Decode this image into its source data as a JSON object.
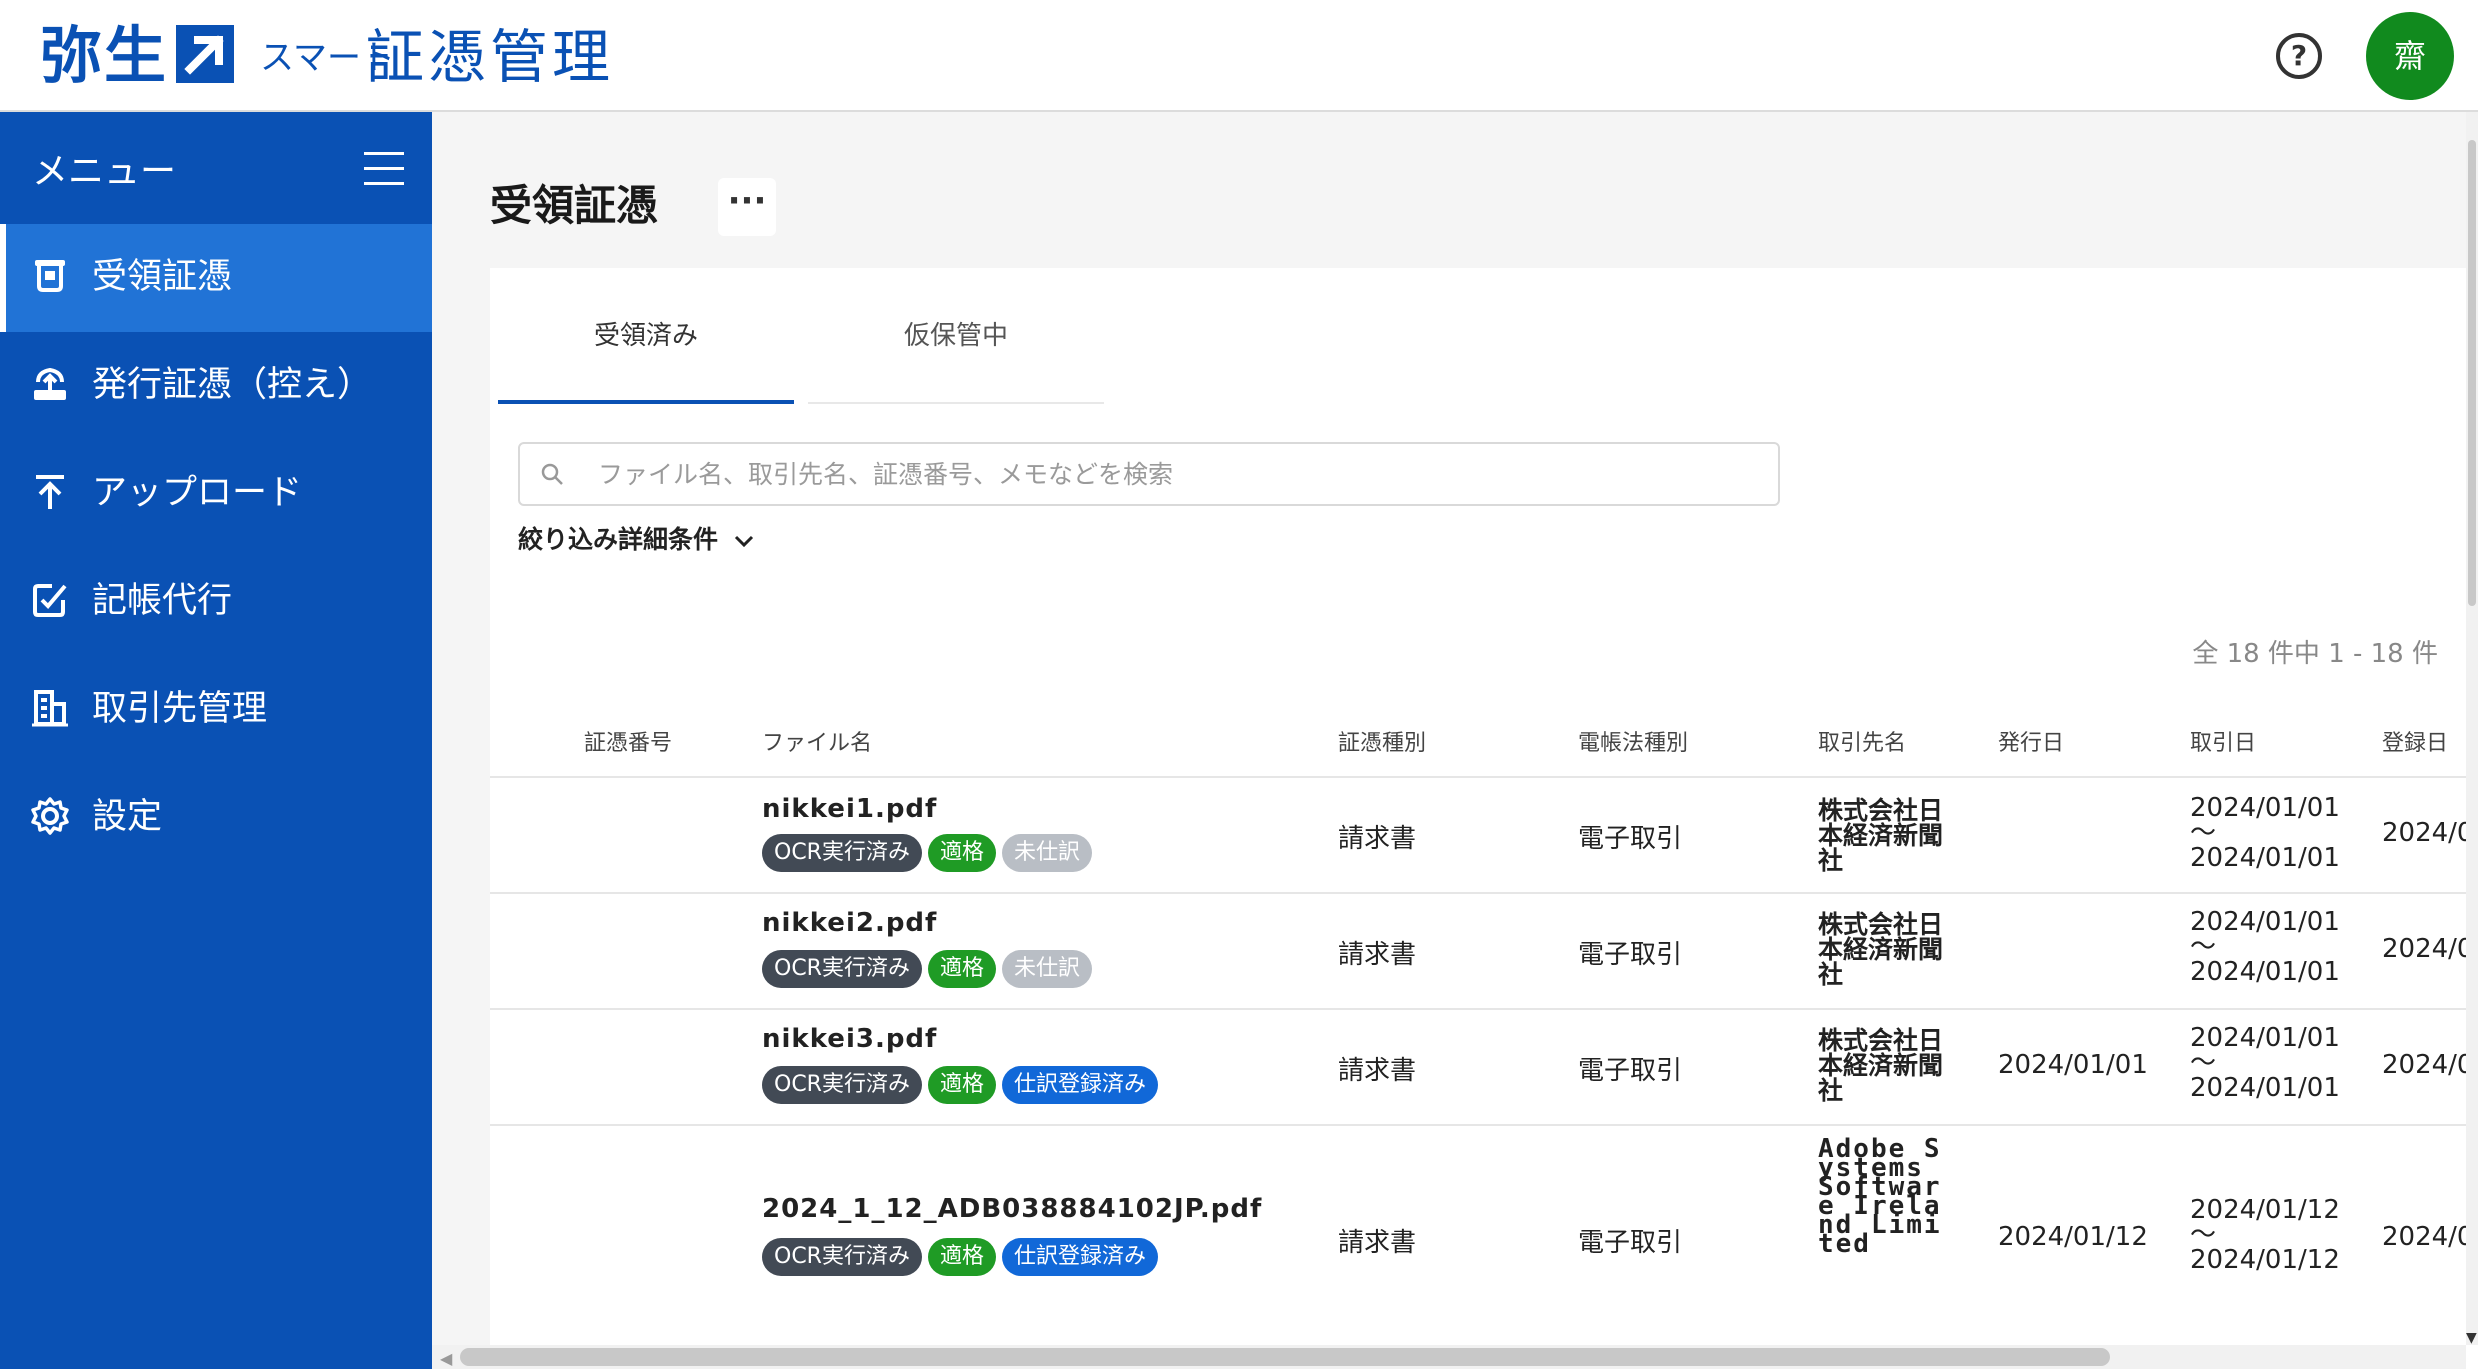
{
  "header": {
    "brand": "弥生",
    "brand_sub": "スマート",
    "product": "証憑管理",
    "help_label": "?",
    "avatar_label": "齋"
  },
  "sidebar": {
    "menu_title": "メニュー",
    "items": [
      {
        "label": "受領証憑",
        "icon": "receipt-hand-icon",
        "active": true
      },
      {
        "label": "発行証憑（控え）",
        "icon": "issue-upload-icon",
        "active": false
      },
      {
        "label": "アップロード",
        "icon": "upload-icon",
        "active": false
      },
      {
        "label": "記帳代行",
        "icon": "bookkeeping-edit-icon",
        "active": false
      },
      {
        "label": "取引先管理",
        "icon": "building-icon",
        "active": false
      },
      {
        "label": "設定",
        "icon": "gear-icon",
        "active": false
      }
    ]
  },
  "main": {
    "page_title": "受領証憑",
    "more_label": "···",
    "tabs": [
      {
        "label": "受領済み",
        "active": true
      },
      {
        "label": "仮保管中",
        "active": false
      }
    ],
    "search": {
      "placeholder": "ファイル名、取引先名、証憑番号、メモなどを検索",
      "value": ""
    },
    "filter_label": "絞り込み詳細条件",
    "count_text": "全 18 件中 1 - 18 件",
    "columns": [
      "証憑番号",
      "ファイル名",
      "証憑種別",
      "電帳法種別",
      "取引先名",
      "発行日",
      "取引日",
      "登録日"
    ],
    "rows": [
      {
        "number": "",
        "file": "nikkei1.pdf",
        "badges": [
          "OCR実行済み",
          "適格",
          "未仕訳"
        ],
        "type": "請求書",
        "law_type": "電子取引",
        "partner": "株式会社日本経済新聞社",
        "issue_date": "",
        "trade_from": "2024/01/01",
        "trade_sep": "～",
        "trade_to": "2024/01/01",
        "registered": "2024/0"
      },
      {
        "number": "",
        "file": "nikkei2.pdf",
        "badges": [
          "OCR実行済み",
          "適格",
          "未仕訳"
        ],
        "type": "請求書",
        "law_type": "電子取引",
        "partner": "株式会社日本経済新聞社",
        "issue_date": "",
        "trade_from": "2024/01/01",
        "trade_sep": "～",
        "trade_to": "2024/01/01",
        "registered": "2024/0"
      },
      {
        "number": "",
        "file": "nikkei3.pdf",
        "badges": [
          "OCR実行済み",
          "適格",
          "仕訳登録済み"
        ],
        "type": "請求書",
        "law_type": "電子取引",
        "partner": "株式会社日本経済新聞社",
        "issue_date": "2024/01/01",
        "trade_from": "2024/01/01",
        "trade_sep": "～",
        "trade_to": "2024/01/01",
        "registered": "2024/0"
      },
      {
        "number": "",
        "file": "2024_1_12_ADB038884102JP.pdf",
        "badges": [
          "OCR実行済み",
          "適格",
          "仕訳登録済み"
        ],
        "type": "請求書",
        "law_type": "電子取引",
        "partner": "Adobe Systems Software Ireland Limited",
        "issue_date": "2024/01/12",
        "trade_from": "2024/01/12",
        "trade_sep": "～",
        "trade_to": "2024/01/12",
        "registered": "2024/0"
      }
    ]
  },
  "colors": {
    "brand_blue": "#0a51b4",
    "active_nav": "#2173d6",
    "avatar_green": "#118a1e",
    "badge_ocr": "#424a55",
    "badge_ok": "#1f9b25",
    "badge_unposted": "#b9bec5",
    "badge_registered": "#1168d8"
  }
}
